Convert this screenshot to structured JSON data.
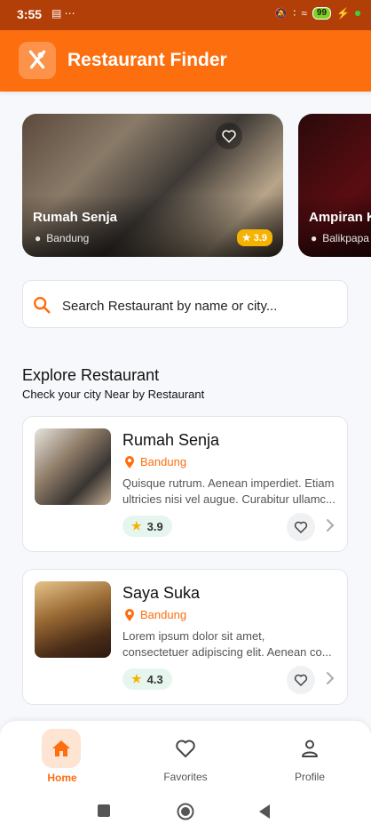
{
  "status_bar": {
    "time": "3:55",
    "battery": "99"
  },
  "app": {
    "title": "Restaurant Finder"
  },
  "featured": [
    {
      "name": "Rumah Senja",
      "city": "Bandung",
      "rating": "3.9"
    },
    {
      "name": "Ampiran K",
      "city": "Balikpapa"
    }
  ],
  "search": {
    "placeholder": "Search Restaurant by name or city..."
  },
  "section": {
    "title": "Explore Restaurant",
    "subtitle": "Check your city Near by Restaurant"
  },
  "restaurants": [
    {
      "name": "Rumah Senja",
      "city": "Bandung",
      "desc_line1": "Quisque rutrum. Aenean imperdiet. Etiam",
      "desc_line2": "ultricies nisi vel augue. Curabitur ullamc...",
      "rating": "3.9"
    },
    {
      "name": "Saya Suka",
      "city": "Bandung",
      "desc_line1": "Lorem ipsum dolor sit amet,",
      "desc_line2": "consectetuer adipiscing elit. Aenean co...",
      "rating": "4.3"
    }
  ],
  "nav": {
    "home": "Home",
    "favorites": "Favorites",
    "profile": "Profile"
  },
  "colors": {
    "primary": "#fd6e0f",
    "status_bar": "#b33f08",
    "rating_star": "#f5b301"
  }
}
